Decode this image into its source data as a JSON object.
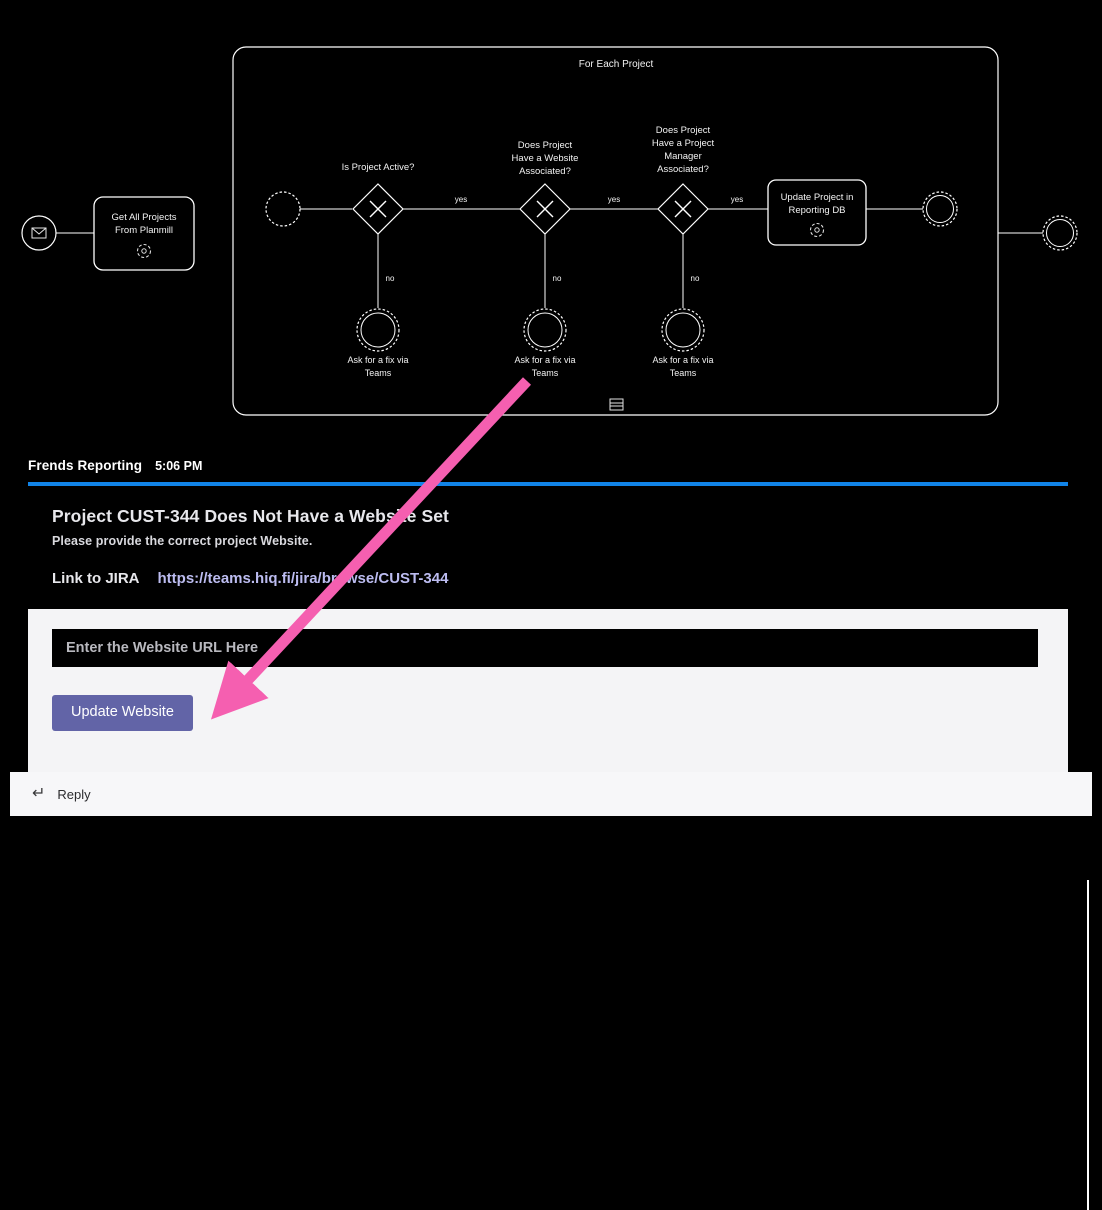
{
  "colors": {
    "card_accent": "#1184e8",
    "button_bg": "#6264a7",
    "link": "#bcbcf0",
    "annotation_arrow": "#f55fb0",
    "diagram_bg": "#000000",
    "diagram_stroke": "#ffffff"
  },
  "message": {
    "sender": "Frends Reporting",
    "timestamp": "5:06 PM"
  },
  "card": {
    "title": "Project CUST-344 Does Not Have a Website Set",
    "subtitle": "Please provide the correct project Website.",
    "link_label": "Link to JIRA",
    "link_url": "https://teams.hiq.fi/jira/browse/CUST-344",
    "input": {
      "placeholder": "Enter the Website URL Here",
      "value": ""
    },
    "submit_label": "Update Website"
  },
  "reply": {
    "icon": "reply-arrow-icon",
    "label": "Reply"
  },
  "diagram": {
    "subprocess_title": "For Each Project",
    "start_event": "message-start-event",
    "task_get_projects": "Get All Projects From Planmill",
    "task_update_project": "Update Project in Reporting DB",
    "gateways": [
      "Is Project Active?",
      "Does Project Have a Website Associated?",
      "Does Project Have a Project Manager Associated?"
    ],
    "flow_yes": "yes",
    "flow_no": "no",
    "intermediate_events": [
      "Ask for a fix via Teams",
      "Ask for a fix via Teams",
      "Ask for a fix via Teams"
    ]
  }
}
